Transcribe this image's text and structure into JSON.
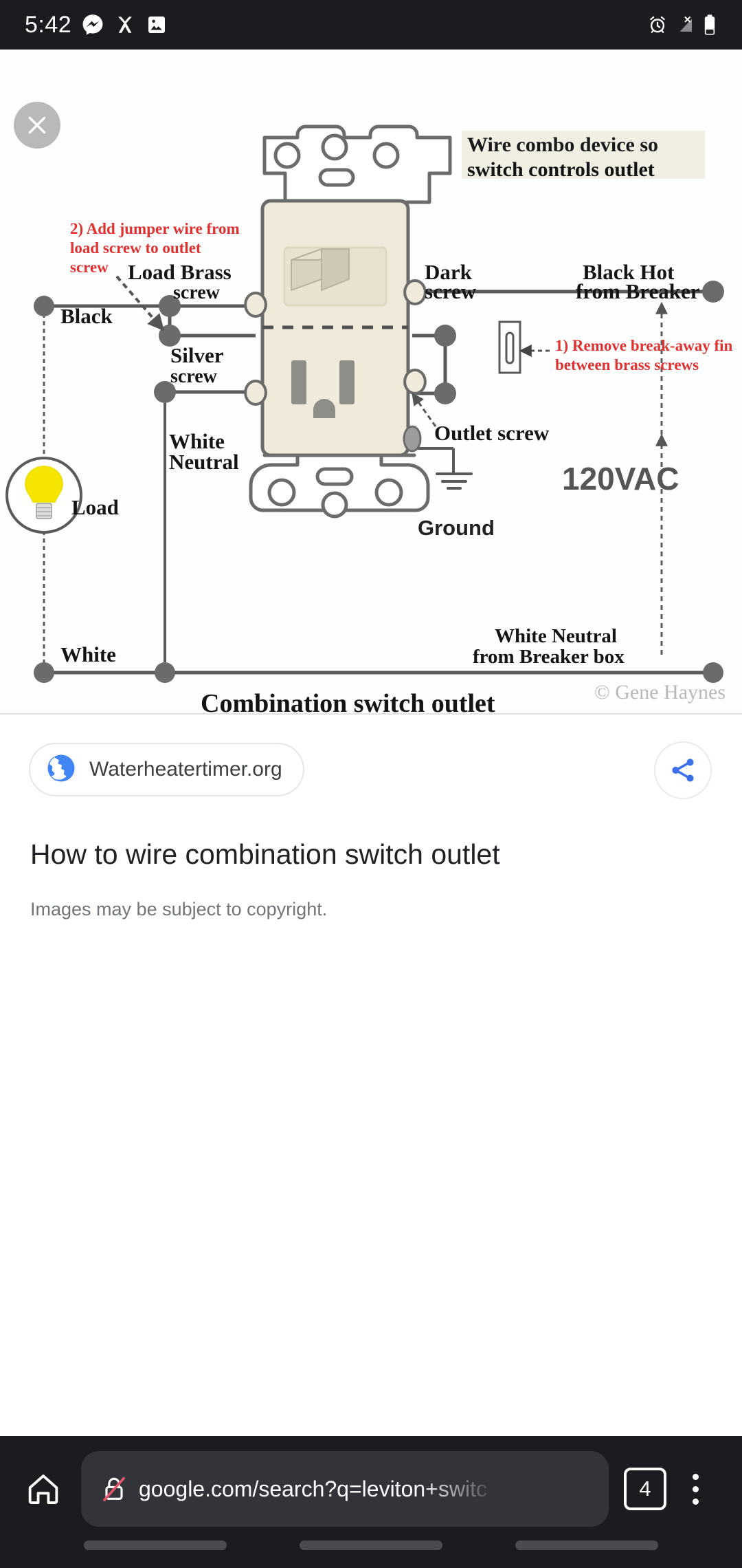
{
  "status_bar": {
    "time": "5:42",
    "left_icons": [
      "messenger-icon",
      "snapchat-icon",
      "gallery-icon"
    ],
    "right_icons": [
      "alarm-icon",
      "no-signal-icon",
      "battery-icon"
    ]
  },
  "viewer": {
    "close_icon": "close-icon",
    "image_alt": "Combination switch outlet wiring diagram"
  },
  "diagram": {
    "title_box": "Wire combo device so switch controls outlet",
    "caption": "Combination switch outlet",
    "copyright": "© Gene Haynes",
    "voltage_label": "120VAC",
    "annotations": [
      {
        "id": "note-2",
        "text": "2) Add jumper wire from load screw to outlet screw",
        "color": "#e03131"
      },
      {
        "id": "note-1",
        "text": "1) Remove break-away fin between brass screws",
        "color": "#e03131"
      }
    ],
    "labels": [
      {
        "id": "load-brass-screw",
        "text": "Load Brass screw"
      },
      {
        "id": "black",
        "text": "Black"
      },
      {
        "id": "silver-screw",
        "text": "Silver screw"
      },
      {
        "id": "white-neutral",
        "text": "White Neutral"
      },
      {
        "id": "load",
        "text": "Load"
      },
      {
        "id": "white",
        "text": "White"
      },
      {
        "id": "dark-screw",
        "text": "Dark screw"
      },
      {
        "id": "black-hot-from-breaker",
        "text": "Black Hot from Breaker"
      },
      {
        "id": "outlet-screw",
        "text": "Outlet screw"
      },
      {
        "id": "ground",
        "text": "Ground"
      },
      {
        "id": "white-neutral-from-breaker",
        "text": "White Neutral from Breaker box"
      }
    ],
    "colors": {
      "wire": "#555555",
      "body": "#efead9",
      "bulb": "#f5e500",
      "note": "#e03131",
      "title_bg": "#f1efe4"
    }
  },
  "info": {
    "source_name": "Waterheatertimer.org",
    "source_icon": "globe-icon",
    "share_icon": "share-icon",
    "title": "How to wire combination switch outlet",
    "subtitle": "Images may be subject to copyright."
  },
  "browser_bar": {
    "home_icon": "home-icon",
    "security_icon": "insecure-lock-icon",
    "url": "google.com/search?q=leviton+switc",
    "tab_count": "4",
    "menu_icon": "overflow-menu-icon"
  }
}
